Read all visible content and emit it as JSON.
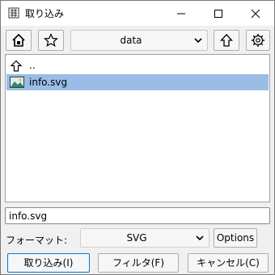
{
  "window": {
    "title": "取り込み",
    "app_icon": "importer-icon"
  },
  "toolbar": {
    "home_icon": "home-icon",
    "bookmark_icon": "star-icon",
    "directory": "data",
    "up_icon": "arrow-up-icon",
    "settings_icon": "gear-icon"
  },
  "files": [
    {
      "name": "..",
      "icon": "parent-dir-icon",
      "selected": false
    },
    {
      "name": "info.svg",
      "icon": "image-file-icon",
      "selected": true
    }
  ],
  "filename_value": "info.svg",
  "format": {
    "label": "フォーマット:",
    "value": "SVG",
    "options_label": "Options"
  },
  "buttons": {
    "import": "取り込み(I)",
    "filter": "フィルタ(F)",
    "cancel": "キャンセル(C)"
  },
  "colors": {
    "selection": "#99bde6",
    "default_button_border": "#0078d7"
  }
}
